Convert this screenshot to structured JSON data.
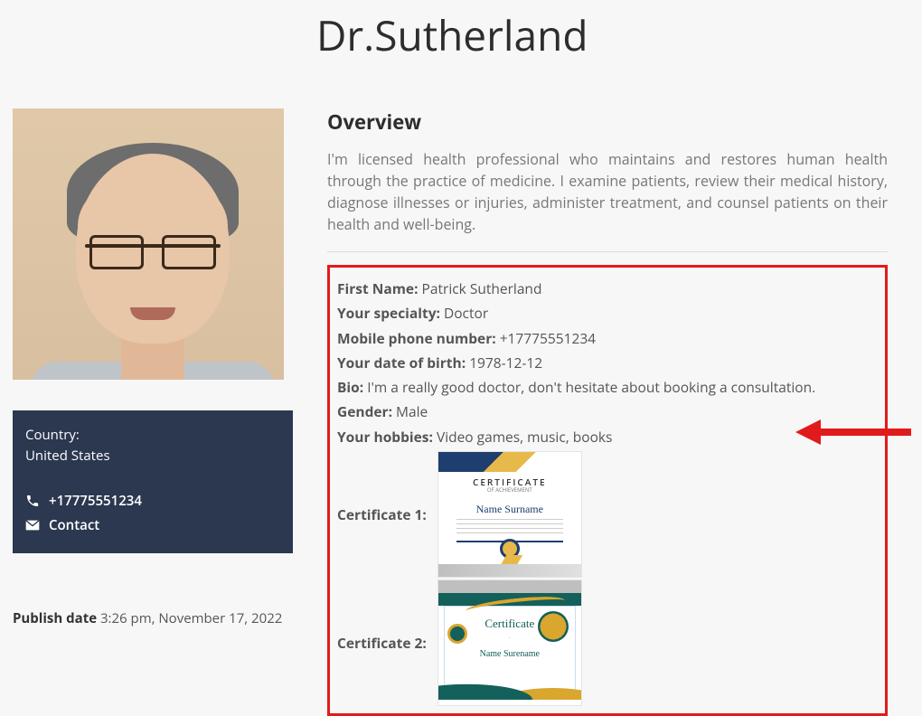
{
  "page_title": "Dr.Sutherland",
  "left": {
    "country_label": "Country:",
    "country_value": "United States",
    "phone": "+17775551234",
    "contact": "Contact"
  },
  "publish": {
    "label": "Publish date",
    "value": "3:26 pm, November 17, 2022"
  },
  "overview": {
    "heading": "Overview",
    "text": "I'm licensed health professional who maintains and restores human health through the practice of medicine. I examine patients, review their medical history, diagnose illnesses or injuries, administer treatment, and counsel patients on their health and well-being."
  },
  "details": {
    "first_name": {
      "k": "First Name:",
      "v": "Patrick Sutherland"
    },
    "specialty": {
      "k": "Your specialty:",
      "v": "Doctor"
    },
    "mobile": {
      "k": "Mobile phone number:",
      "v": "+17775551234"
    },
    "dob": {
      "k": "Your date of birth:",
      "v": "1978-12-12"
    },
    "bio": {
      "k": "Bio:",
      "v": "I'm a really good doctor, don't hesitate about booking a consultation."
    },
    "gender": {
      "k": "Gender:",
      "v": "Male"
    },
    "hobbies": {
      "k": "Your hobbies:",
      "v": "Video games, music, books"
    },
    "cert1_label": "Certificate 1:",
    "cert2_label": "Certificate 2:",
    "cert1": {
      "title": "CERTIFICATE",
      "sub": "OF ACHIEVEMENT",
      "name": "Name Surname"
    },
    "cert2": {
      "title": "Certificate",
      "name": "Name Surename"
    }
  },
  "colors": {
    "highlight_border": "#e11b1b",
    "info_card_bg": "#2c3850",
    "arrow": "#e11b1b"
  }
}
